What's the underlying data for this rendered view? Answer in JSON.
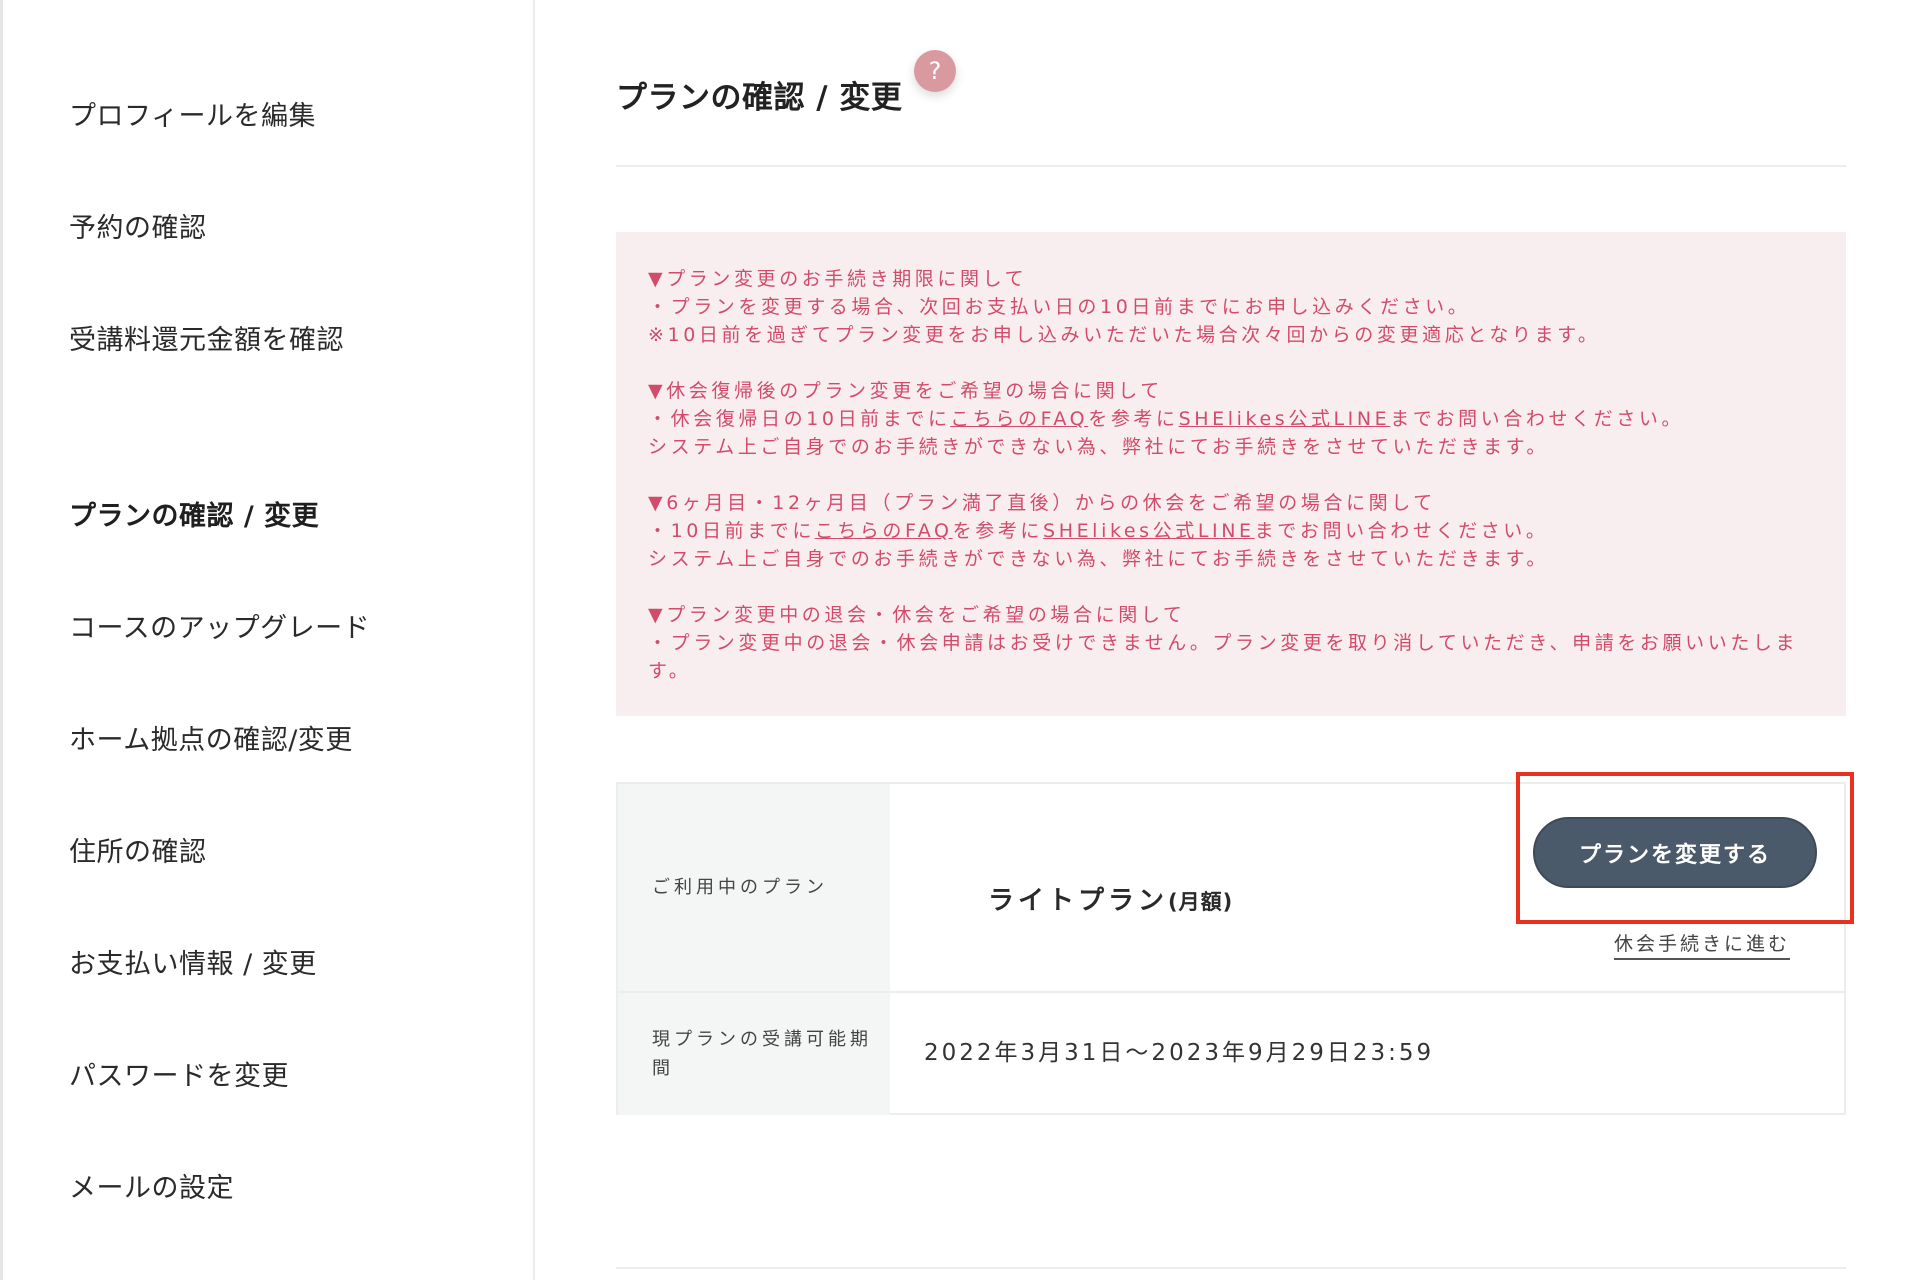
{
  "sidebar": {
    "items": [
      {
        "label": "プロフィールを編集"
      },
      {
        "label": "予約の確認"
      },
      {
        "label": "受講料還元金額を確認"
      },
      {
        "label": "プランの確認 / 変更"
      },
      {
        "label": "コースのアップグレード"
      },
      {
        "label": "ホーム拠点の確認/変更"
      },
      {
        "label": "住所の確認"
      },
      {
        "label": "お支払い情報 / 変更"
      },
      {
        "label": "パスワードを変更"
      },
      {
        "label": "メールの設定"
      }
    ]
  },
  "main": {
    "title": "プランの確認 / 変更",
    "help_icon": "?",
    "notice": {
      "block1": {
        "heading": "▼プラン変更のお手続き期限に関して",
        "line1": "・プランを変更する場合、次回お支払い日の10日前までにお申し込みください。",
        "line2": "※10日前を過ぎてプラン変更をお申し込みいただいた場合次々回からの変更適応となります。"
      },
      "block2": {
        "heading": "▼休会復帰後のプラン変更をご希望の場合に関して",
        "line1_pre": "・休会復帰日の10日前までに",
        "faq_link": "こちらのFAQ",
        "line1_mid": "を参考に",
        "line_link": "SHElikes公式LINE",
        "line1_post": "までお問い合わせください。",
        "line2": "システム上ご自身でのお手続きができない為、弊社にてお手続きをさせていただきます。"
      },
      "block3": {
        "heading": "▼6ヶ月目・12ヶ月目（プラン満了直後）からの休会をご希望の場合に関して",
        "line1_pre": "・10日前までに",
        "faq_link": "こちらのFAQ",
        "line1_mid": "を参考に",
        "line_link": "SHElikes公式LINE",
        "line1_post": "までお問い合わせください。",
        "line2": "システム上ご自身でのお手続きができない為、弊社にてお手続きをさせていただきます。"
      },
      "block4": {
        "heading": "▼プラン変更中の退会・休会をご希望の場合に関して",
        "line1": "・プラン変更中の退会・休会申請はお受けできません。プラン変更を取り消していただき、申請をお願いいたします。"
      }
    },
    "plan_table": {
      "current_plan_label": "ご利用中のプラン",
      "current_plan_name": "ライトプラン",
      "current_plan_suffix": "(月額)",
      "change_button": "プランを変更する",
      "suspend_link": "休会手続きに進む",
      "period_label": "現プランの受講可能期間",
      "period_value": "2022年3月31日〜2023年9月29日23:59"
    }
  },
  "colors": {
    "notice_bg": "#f8eef0",
    "notice_text": "#d24b6a",
    "button_bg": "#4b5a6a",
    "highlight": "#e8321f",
    "help_badge": "#d99a9f"
  }
}
